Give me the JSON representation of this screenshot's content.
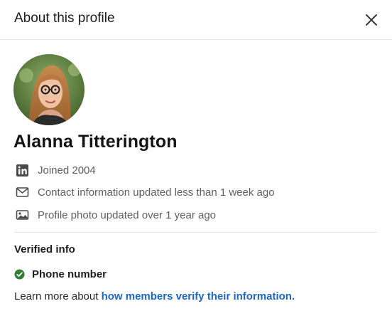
{
  "header": {
    "title": "About this profile",
    "close_icon": "close-icon"
  },
  "profile": {
    "name": "Alanna Titterington",
    "avatar_icon": "profile-photo"
  },
  "details": [
    {
      "icon": "linkedin-icon",
      "text": "Joined 2004"
    },
    {
      "icon": "mail-icon",
      "text": "Contact information updated less than 1 week ago"
    },
    {
      "icon": "image-icon",
      "text": "Profile photo updated over 1 year ago"
    }
  ],
  "verified": {
    "title": "Verified info",
    "items": [
      {
        "icon": "check-circle-icon",
        "label": "Phone number"
      }
    ],
    "learn_more_prefix": "Learn more about ",
    "learn_more_link": "how members verify their information."
  },
  "colors": {
    "link": "#1d66c2",
    "verified_check": "#2e7d32",
    "secondary_text": "#5e5e5e"
  }
}
